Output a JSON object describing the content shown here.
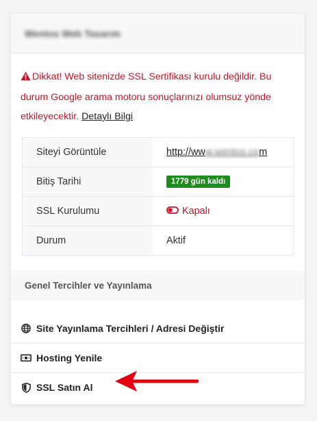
{
  "header": {
    "title": "Wentos Web Tasarım"
  },
  "alert": {
    "message": "Dikkat! Web sitenizde SSL Sertifikası kurulu değildir. Bu durum Google arama motoru sonuçlarınızı olumsuz yönde etkileyecektir.",
    "link_label": "Detaylı Bilgi"
  },
  "info": {
    "rows": [
      {
        "label": "Siteyi Görüntüle",
        "url_prefix": "http://ww",
        "url_hidden": "w.wentos.co",
        "url_suffix": "m"
      },
      {
        "label": "Bitiş Tarihi",
        "badge": "1779 gün kaldı"
      },
      {
        "label": "SSL Kurulumu",
        "status": "Kapalı"
      },
      {
        "label": "Durum",
        "value": "Aktif"
      }
    ]
  },
  "section": {
    "title": "Genel Tercihler ve Yayınlama"
  },
  "menu": {
    "items": [
      {
        "label": "Site Yayınlama Tercihleri / Adresi Değiştir",
        "icon": "globe-icon"
      },
      {
        "label": "Hosting Yenile",
        "icon": "money-bill-icon"
      },
      {
        "label": "SSL Satın Al",
        "icon": "shield-icon"
      }
    ]
  },
  "colors": {
    "danger": "#c4152a",
    "success": "#1f8c1f",
    "annotation_arrow": "#e3000f"
  }
}
